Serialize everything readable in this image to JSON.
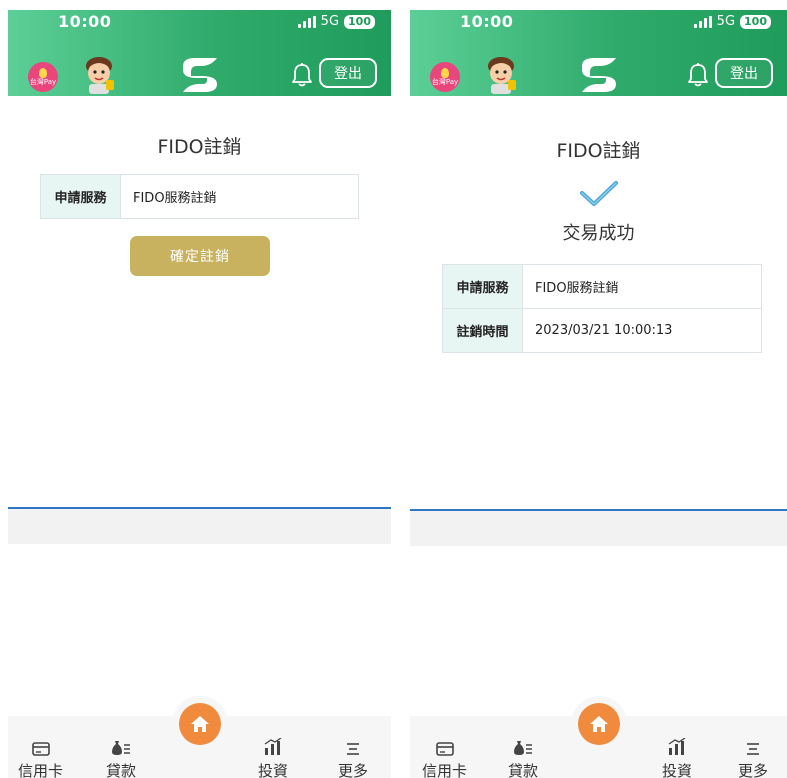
{
  "status_bar": {
    "time": "10:00",
    "network": "5G",
    "battery": "100"
  },
  "header": {
    "taiwanpay_label": "台灣Pay",
    "logout_label": "登出"
  },
  "left_screen": {
    "title": "FIDO註銷",
    "rows": [
      {
        "label": "申請服務",
        "value": "FIDO服務註銷"
      }
    ],
    "confirm_button": "確定註銷"
  },
  "right_screen": {
    "title": "FIDO註銷",
    "success_text": "交易成功",
    "rows": [
      {
        "label": "申請服務",
        "value": "FIDO服務註銷"
      },
      {
        "label": "註銷時間",
        "value": "2023/03/21 10:00:13"
      }
    ]
  },
  "bottom_nav": {
    "items": [
      {
        "label": "信用卡",
        "icon": "credit-card-icon"
      },
      {
        "label": "貸款",
        "icon": "money-bag-icon"
      },
      {
        "label": "",
        "icon": "home-icon"
      },
      {
        "label": "投資",
        "icon": "chart-icon"
      },
      {
        "label": "更多",
        "icon": "menu-icon"
      }
    ]
  },
  "colors": {
    "header_green": "#2faa6a",
    "confirm_gold": "#c9b25f",
    "table_label_bg": "#e8f6f3",
    "home_orange": "#f08a3c",
    "divider_blue": "#2e75c4"
  }
}
